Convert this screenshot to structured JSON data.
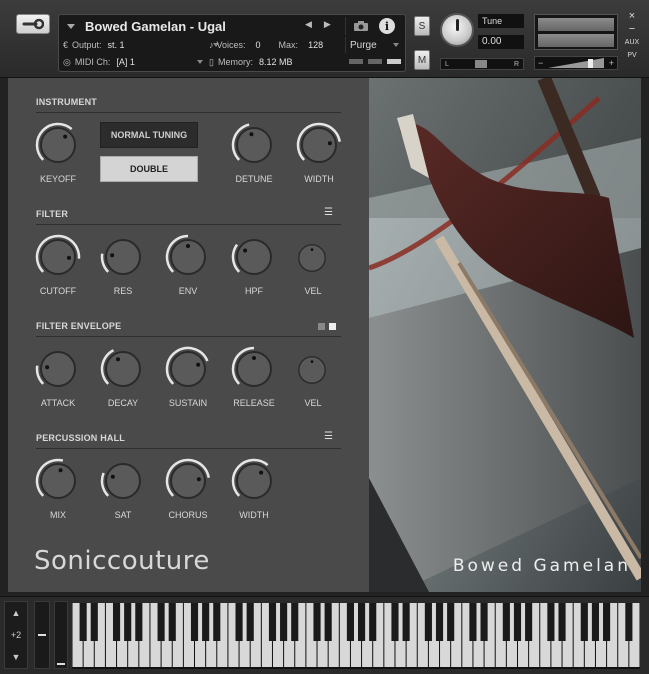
{
  "header": {
    "instrument_name": "Bowed Gamelan - Ugal",
    "output_label": "Output:",
    "output_value": "st. 1",
    "voices_label": "Voices:",
    "voices_value": "0",
    "max_label": "Max:",
    "max_value": "128",
    "midi_label": "MIDI Ch:",
    "midi_value": "[A]  1",
    "memory_label": "Memory:",
    "memory_value": "8.12 MB",
    "purge_label": "Purge",
    "solo_label": "S",
    "mute_label": "M",
    "tune_label": "Tune",
    "tune_value": "0.00",
    "pan_left": "L",
    "pan_right": "R",
    "vol_minus": "−",
    "vol_plus": "+",
    "aux_label": "AUX",
    "pv_label": "PV",
    "close_label": "×",
    "min_label": "−"
  },
  "sections": {
    "instrument": {
      "title": "INSTRUMENT",
      "normal_tuning": "NORMAL TUNING",
      "double": "DOUBLE",
      "knobs": [
        "KEYOFF",
        "DETUNE",
        "WIDTH"
      ]
    },
    "filter": {
      "title": "FILTER",
      "knobs": [
        "CUTOFF",
        "RES",
        "ENV",
        "HPF",
        "VEL"
      ]
    },
    "filter_envelope": {
      "title": "FILTER ENVELOPE",
      "knobs": [
        "ATTACK",
        "DECAY",
        "SUSTAIN",
        "RELEASE",
        "VEL"
      ]
    },
    "percussion_hall": {
      "title": "PERCUSSION HALL",
      "knobs": [
        "MIX",
        "SAT",
        "CHORUS",
        "WIDTH"
      ]
    }
  },
  "brand": "Soniccouture",
  "artwork_caption": "Bowed Gamelan",
  "keyboard": {
    "octave_value": "+2",
    "up_arrow": "▲",
    "down_arrow": "▼"
  },
  "knob_levels": {
    "keyoff": 0.65,
    "detune": 0.45,
    "width": 0.8,
    "cutoff": 0.85,
    "res": 0.2,
    "env": 0.5,
    "hpf": 0.3,
    "filter_vel": 0.5,
    "attack": 0.2,
    "decay": 0.4,
    "sustain": 0.75,
    "release": 0.5,
    "env_vel": 0.5,
    "mix": 0.55,
    "sat": 0.25,
    "chorus": 0.8,
    "ph_width": 0.65
  }
}
